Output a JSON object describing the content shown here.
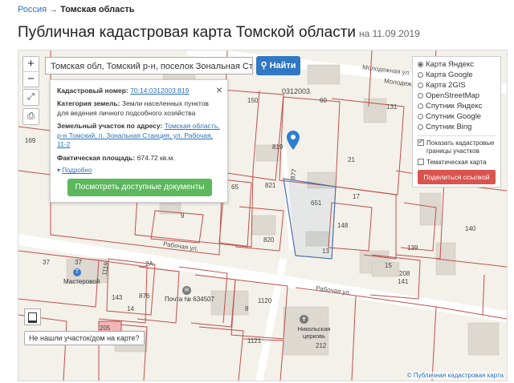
{
  "breadcrumb": {
    "root": "Россия",
    "arrow": "→",
    "current": "Томская область"
  },
  "page": {
    "title": "Публичная кадастровая карта Томской области",
    "date": "на 11.09.2019"
  },
  "map": {
    "zoom_in": "+",
    "zoom_out": "−",
    "search_value": "Томская обл, Томский р-н, поселок Зональная Станция",
    "search_button": "Найти",
    "popup": {
      "close": "×",
      "cad_number_label": "Кадастровый номер:",
      "cad_number": "70:14:0312003:819",
      "category_label": "Категория земель:",
      "category_value": "Земли населенных пунктов для ведения личного подсобного хозяйства",
      "address_label": "Земельный участок по адресу:",
      "address_value": "Томская область, р-н Томский, п. Зональная Станция, ул. Рабочая, 11-2",
      "area_label": "Фактическая площадь:",
      "area_value": "674.72 кв.м.",
      "more": "Подробно",
      "docs_button": "Посмотреть доступные документы"
    },
    "layers": {
      "options": [
        "Карта Яндекс",
        "Карта Google",
        "Карта 2GIS",
        "OpenStreetMap",
        "Спутник Яндекс",
        "Спутник Google",
        "Спутник Bing"
      ],
      "selected": "Карта Яндекс",
      "cadastral_label": "Показать кадастровые границы участков",
      "cadastral_checked": true,
      "thematic_label": "Тематическая карта",
      "thematic_checked": false,
      "share_button": "Поделиться ссылкой"
    },
    "not_found": "Не нашли участок/дом на карте?",
    "attribution": "© Публичная кадастровая карта",
    "labels": {
      "block": "0312003",
      "street1": "Молодежная ул.",
      "street2": "Рабочая ул.",
      "p150": "150",
      "p60": "60",
      "p131": "131",
      "p819": "819",
      "p877": "877",
      "p21": "21",
      "p821": "821",
      "p65": "65",
      "p651": "651",
      "p17": "17",
      "p9": "9",
      "p820": "820",
      "p148": "148",
      "p13": "13",
      "p140": "140",
      "p37a": "37",
      "p37b": "37",
      "p2a": "2А",
      "p876": "876",
      "p1119": "1119",
      "p143": "143",
      "p14": "14",
      "p15": "15",
      "p208": "208",
      "p141": "141",
      "p139": "139",
      "p1120": "1120",
      "p8": "8",
      "p1121": "1121",
      "p212": "212",
      "p205": "205",
      "p169": "169",
      "poi_shop": "Мастеровой",
      "poi_post": "Почта № 634507",
      "poi_church": "Никольская церковь"
    }
  }
}
